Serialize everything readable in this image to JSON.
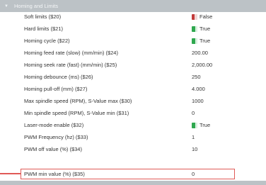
{
  "section": {
    "title": "Homing and Limits"
  },
  "settings": [
    {
      "label": "Soft limits ($20)",
      "value": "False",
      "toggle": "off"
    },
    {
      "label": "Hard limits ($21)",
      "value": "True",
      "toggle": "on"
    },
    {
      "label": "Homing cycle ($22)",
      "value": "True",
      "toggle": "on"
    },
    {
      "label": "Homing feed rate (slow) (mm/min) ($24)",
      "value": "200.00"
    },
    {
      "label": "Homing seek rate (fast) (mm/min) ($25)",
      "value": "2,000.00"
    },
    {
      "label": "Homing debounce (ms) ($26)",
      "value": "250"
    },
    {
      "label": "Homing pull-off (mm) ($27)",
      "value": "4.000"
    },
    {
      "label": "Max spindle speed (RPM), S-Value max ($30)",
      "value": "1000"
    },
    {
      "label": "Min spindle speed (RPM), S-Value min ($31)",
      "value": "0"
    },
    {
      "label": "Laser-mode enable ($32)",
      "value": "True",
      "toggle": "on"
    },
    {
      "label": "PWM Frequency (hz) ($33)",
      "value": "1"
    },
    {
      "label": "PWM off value (%) ($34)",
      "value": "10"
    },
    {
      "label": "PWM min value (%) ($35)",
      "value": "0"
    }
  ]
}
